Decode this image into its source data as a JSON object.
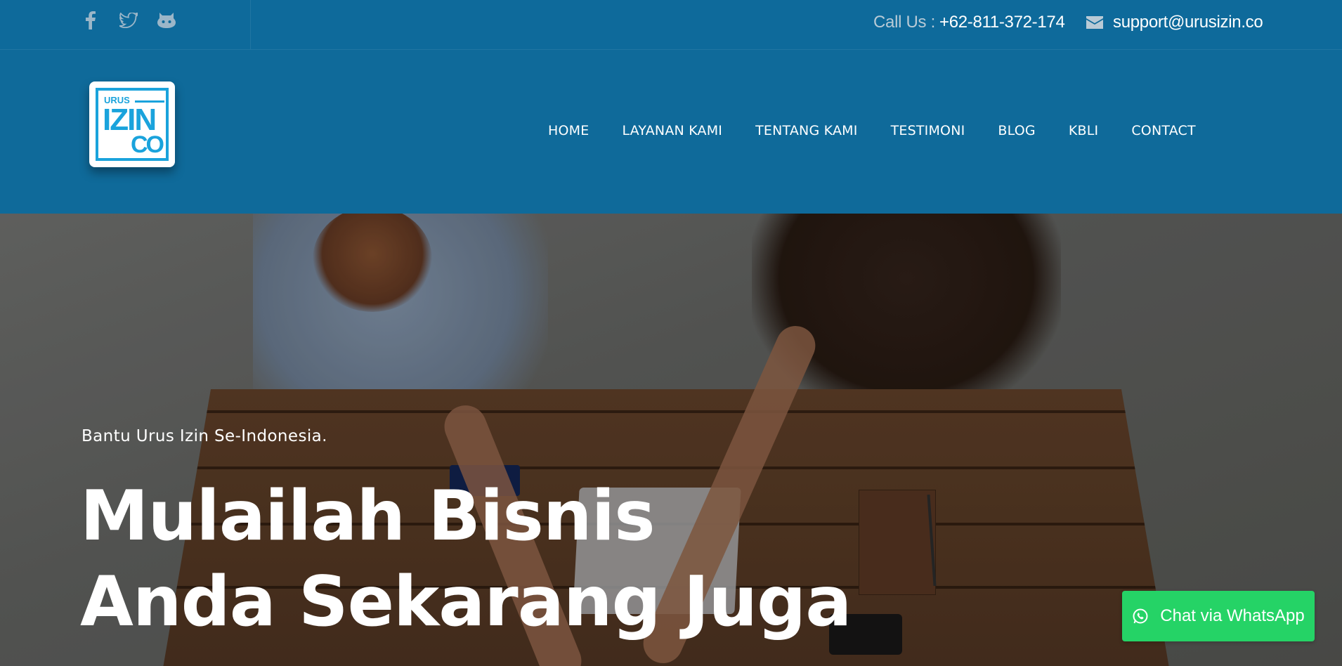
{
  "topbar": {
    "social_icons": [
      "facebook-icon",
      "twitter-icon",
      "github-icon"
    ],
    "call_label": "Call Us :",
    "phone": "+62-811-372-174",
    "email": "support@urusizin.co"
  },
  "header": {
    "logo_text": {
      "small": "URUS",
      "big": "IZIN",
      "suffix": "CO"
    },
    "nav": [
      "HOME",
      "LAYANAN KAMI",
      "TENTANG KAMI",
      "TESTIMONI",
      "BLOG",
      "KBLI",
      "CONTACT"
    ]
  },
  "hero": {
    "subtitle": "Bantu Urus Izin Se-Indonesia.",
    "title_line1": "Mulailah Bisnis",
    "title_line2": "Anda Sekarang Juga"
  },
  "whatsapp": {
    "label": "Chat via WhatsApp"
  },
  "colors": {
    "header_bg": "#0f6a9a",
    "logo_blue": "#1aa3dc",
    "whatsapp_green": "#25d366"
  }
}
